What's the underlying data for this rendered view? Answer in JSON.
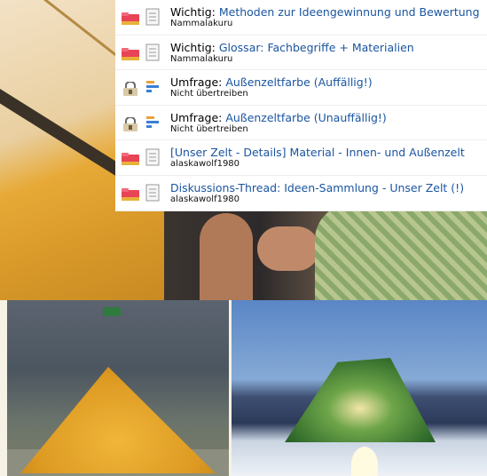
{
  "threads": [
    {
      "prefix": "Wichtig:",
      "title": "Methoden zur Ideengewinnung und Bewertung",
      "author": "Nammalakuru",
      "icon": "folder-icon",
      "type_icon": "document-icon"
    },
    {
      "prefix": "Wichtig:",
      "title": "Glossar: Fachbegriffe + Materialien",
      "author": "Nammalakuru",
      "icon": "folder-icon",
      "type_icon": "document-icon"
    },
    {
      "prefix": "Umfrage:",
      "title": "Außenzeltfarbe (Auffällig!)",
      "author": "Nicht übertreiben",
      "icon": "lock-icon",
      "type_icon": "poll-icon"
    },
    {
      "prefix": "Umfrage:",
      "title": "Außenzeltfarbe (Unauffällig!)",
      "author": "Nicht übertreiben",
      "icon": "lock-icon",
      "type_icon": "poll-icon"
    },
    {
      "prefix": "",
      "title": "[Unser Zelt - Details] Material - Innen- und Außenzelt",
      "author": "alaskawolf1980",
      "icon": "folder-icon",
      "type_icon": "document-icon"
    },
    {
      "prefix": "",
      "title": "Diskussions-Thread: Ideen-Sammlung - Unser Zelt (!)",
      "author": "alaskawolf1980",
      "icon": "folder-icon",
      "type_icon": "document-icon"
    }
  ],
  "colors": {
    "link": "#1a55a0",
    "folder": "#e94456"
  }
}
